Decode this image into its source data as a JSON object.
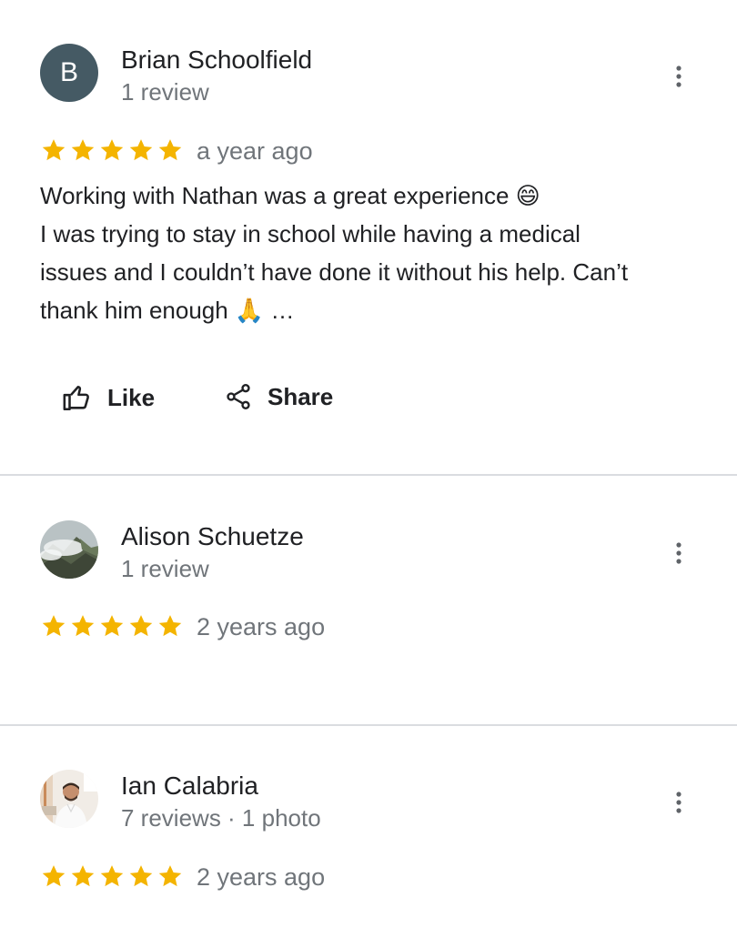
{
  "reviews": [
    {
      "avatar_letter": "B",
      "avatar_color": "#455a64",
      "name": "Brian Schoolfield",
      "meta": "1 review",
      "rating": 5,
      "time": "a year ago",
      "text_lines": [
        "Working with Nathan was a great experience 😄",
        "I was trying to stay in school while having a medical",
        "issues and I couldn’t have done it without his help. Can’t",
        "thank him enough 🙏"
      ],
      "ellipsis": "…",
      "like_label": "Like",
      "share_label": "Share"
    },
    {
      "avatar_photo": "mountain-clouds-photo",
      "name": "Alison Schuetze",
      "meta": "1 review",
      "rating": 5,
      "time": "2 years ago"
    },
    {
      "avatar_photo": "man-white-shirt-photo",
      "name": "Ian Calabria",
      "meta": "7 reviews · 1 photo",
      "rating": 5,
      "time": "2 years ago"
    }
  ],
  "colors": {
    "star": "#f4b400",
    "secondary_text": "#70757a",
    "divider": "#dadce0"
  }
}
